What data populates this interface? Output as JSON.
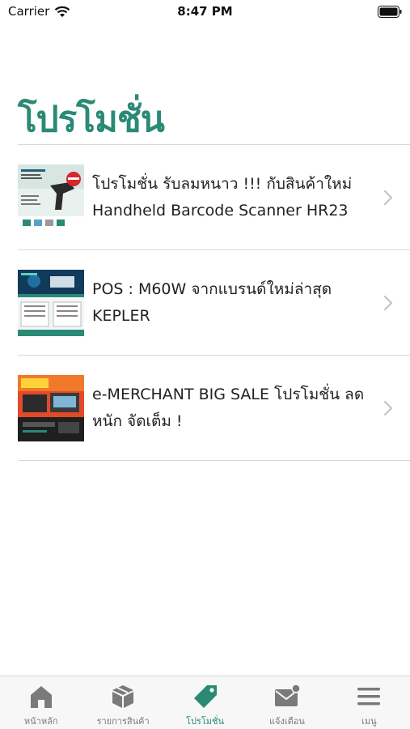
{
  "status_bar": {
    "carrier": "Carrier",
    "time": "8:47 PM"
  },
  "page": {
    "title": "โปรโมชั่น"
  },
  "promotions": [
    {
      "title": "โปรโมชั่น รับลมหนาว !!! กับสินค้าใหม่ Handheld Barcode Scanner HR23",
      "thumbnail": "barcode-scanner-promo-image"
    },
    {
      "title": "POS : M60W จากแบรนด์ใหม่ล่าสุด KEPLER",
      "thumbnail": "pos-m60w-promo-image"
    },
    {
      "title": "e-MERCHANT BIG SALE โปรโมชั่น ลดหนัก จัดเต็ม !",
      "thumbnail": "big-sale-promo-image"
    }
  ],
  "tab_bar": {
    "tabs": [
      {
        "label": "หน้าหลัก",
        "icon": "home-icon",
        "active": false
      },
      {
        "label": "รายการสินค้า",
        "icon": "box-icon",
        "active": false
      },
      {
        "label": "โปรโมชั่น",
        "icon": "tag-icon",
        "active": true
      },
      {
        "label": "แจ้งเตือน",
        "icon": "mail-icon",
        "active": false
      },
      {
        "label": "เมนู",
        "icon": "menu-icon",
        "active": false
      }
    ]
  },
  "colors": {
    "accent": "#2a8a76",
    "inactive": "#7a7a7a"
  }
}
